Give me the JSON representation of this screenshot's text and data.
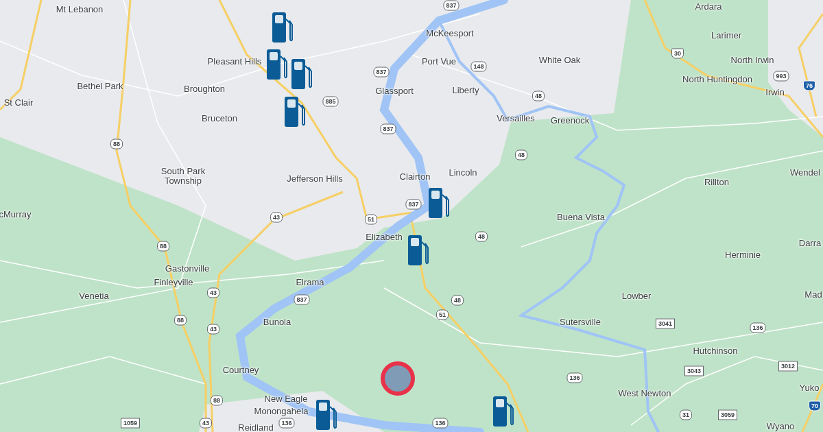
{
  "map": {
    "places": [
      {
        "label": "Mt Lebanon"
      },
      {
        "label": "Ardara"
      },
      {
        "label": "McKeesport"
      },
      {
        "label": "Larimer"
      },
      {
        "label": "Pleasant Hills"
      },
      {
        "label": "Port Vue"
      },
      {
        "label": "White Oak"
      },
      {
        "label": "North Irwin"
      },
      {
        "label": "Bethel Park"
      },
      {
        "label": "Broughton"
      },
      {
        "label": "Glassport"
      },
      {
        "label": "Liberty"
      },
      {
        "label": "North Huntingdon"
      },
      {
        "label": "Irwin"
      },
      {
        "label": "St Clair"
      },
      {
        "label": "Bruceton"
      },
      {
        "label": "Versailles"
      },
      {
        "label": "Greenock"
      },
      {
        "label": "South Park Township"
      },
      {
        "label": "Jefferson Hills"
      },
      {
        "label": "Clairton"
      },
      {
        "label": "Lincoln"
      },
      {
        "label": "Rillton"
      },
      {
        "label": "Wendel"
      },
      {
        "label": "cMurray"
      },
      {
        "label": "Buena Vista"
      },
      {
        "label": "Elizabeth"
      },
      {
        "label": "Darra"
      },
      {
        "label": "Herminie"
      },
      {
        "label": "Gastonville"
      },
      {
        "label": "Finleyville"
      },
      {
        "label": "Elrama"
      },
      {
        "label": "Venetia"
      },
      {
        "label": "Lowber"
      },
      {
        "label": "Mad"
      },
      {
        "label": "Bunola"
      },
      {
        "label": "Sutersville"
      },
      {
        "label": "Hutchinson"
      },
      {
        "label": "Courtney"
      },
      {
        "label": "West Newton"
      },
      {
        "label": "Yuko"
      },
      {
        "label": "New Eagle"
      },
      {
        "label": "Monongahela"
      },
      {
        "label": "Reidland"
      },
      {
        "label": "Wyano"
      }
    ],
    "route_shields": [
      {
        "label": "837",
        "kind": "state"
      },
      {
        "label": "30",
        "kind": "us"
      },
      {
        "label": "837",
        "kind": "state"
      },
      {
        "label": "148",
        "kind": "state"
      },
      {
        "label": "993",
        "kind": "state"
      },
      {
        "label": "76",
        "kind": "interstate"
      },
      {
        "label": "885",
        "kind": "state"
      },
      {
        "label": "48",
        "kind": "state"
      },
      {
        "label": "837",
        "kind": "state"
      },
      {
        "label": "88",
        "kind": "state"
      },
      {
        "label": "48",
        "kind": "state"
      },
      {
        "label": "837",
        "kind": "state"
      },
      {
        "label": "43",
        "kind": "state"
      },
      {
        "label": "51",
        "kind": "state"
      },
      {
        "label": "48",
        "kind": "state"
      },
      {
        "label": "88",
        "kind": "state"
      },
      {
        "label": "43",
        "kind": "state"
      },
      {
        "label": "837",
        "kind": "state"
      },
      {
        "label": "48",
        "kind": "state"
      },
      {
        "label": "88",
        "kind": "state"
      },
      {
        "label": "51",
        "kind": "state"
      },
      {
        "label": "43",
        "kind": "state"
      },
      {
        "label": "3041",
        "kind": "county"
      },
      {
        "label": "136",
        "kind": "state"
      },
      {
        "label": "136",
        "kind": "state"
      },
      {
        "label": "3043",
        "kind": "county"
      },
      {
        "label": "3012",
        "kind": "county"
      },
      {
        "label": "88",
        "kind": "state"
      },
      {
        "label": "70",
        "kind": "interstate"
      },
      {
        "label": "31",
        "kind": "state"
      },
      {
        "label": "3059",
        "kind": "county"
      },
      {
        "label": "1059",
        "kind": "county"
      },
      {
        "label": "43",
        "kind": "state"
      },
      {
        "label": "136",
        "kind": "state"
      },
      {
        "label": "136",
        "kind": "state"
      }
    ]
  }
}
